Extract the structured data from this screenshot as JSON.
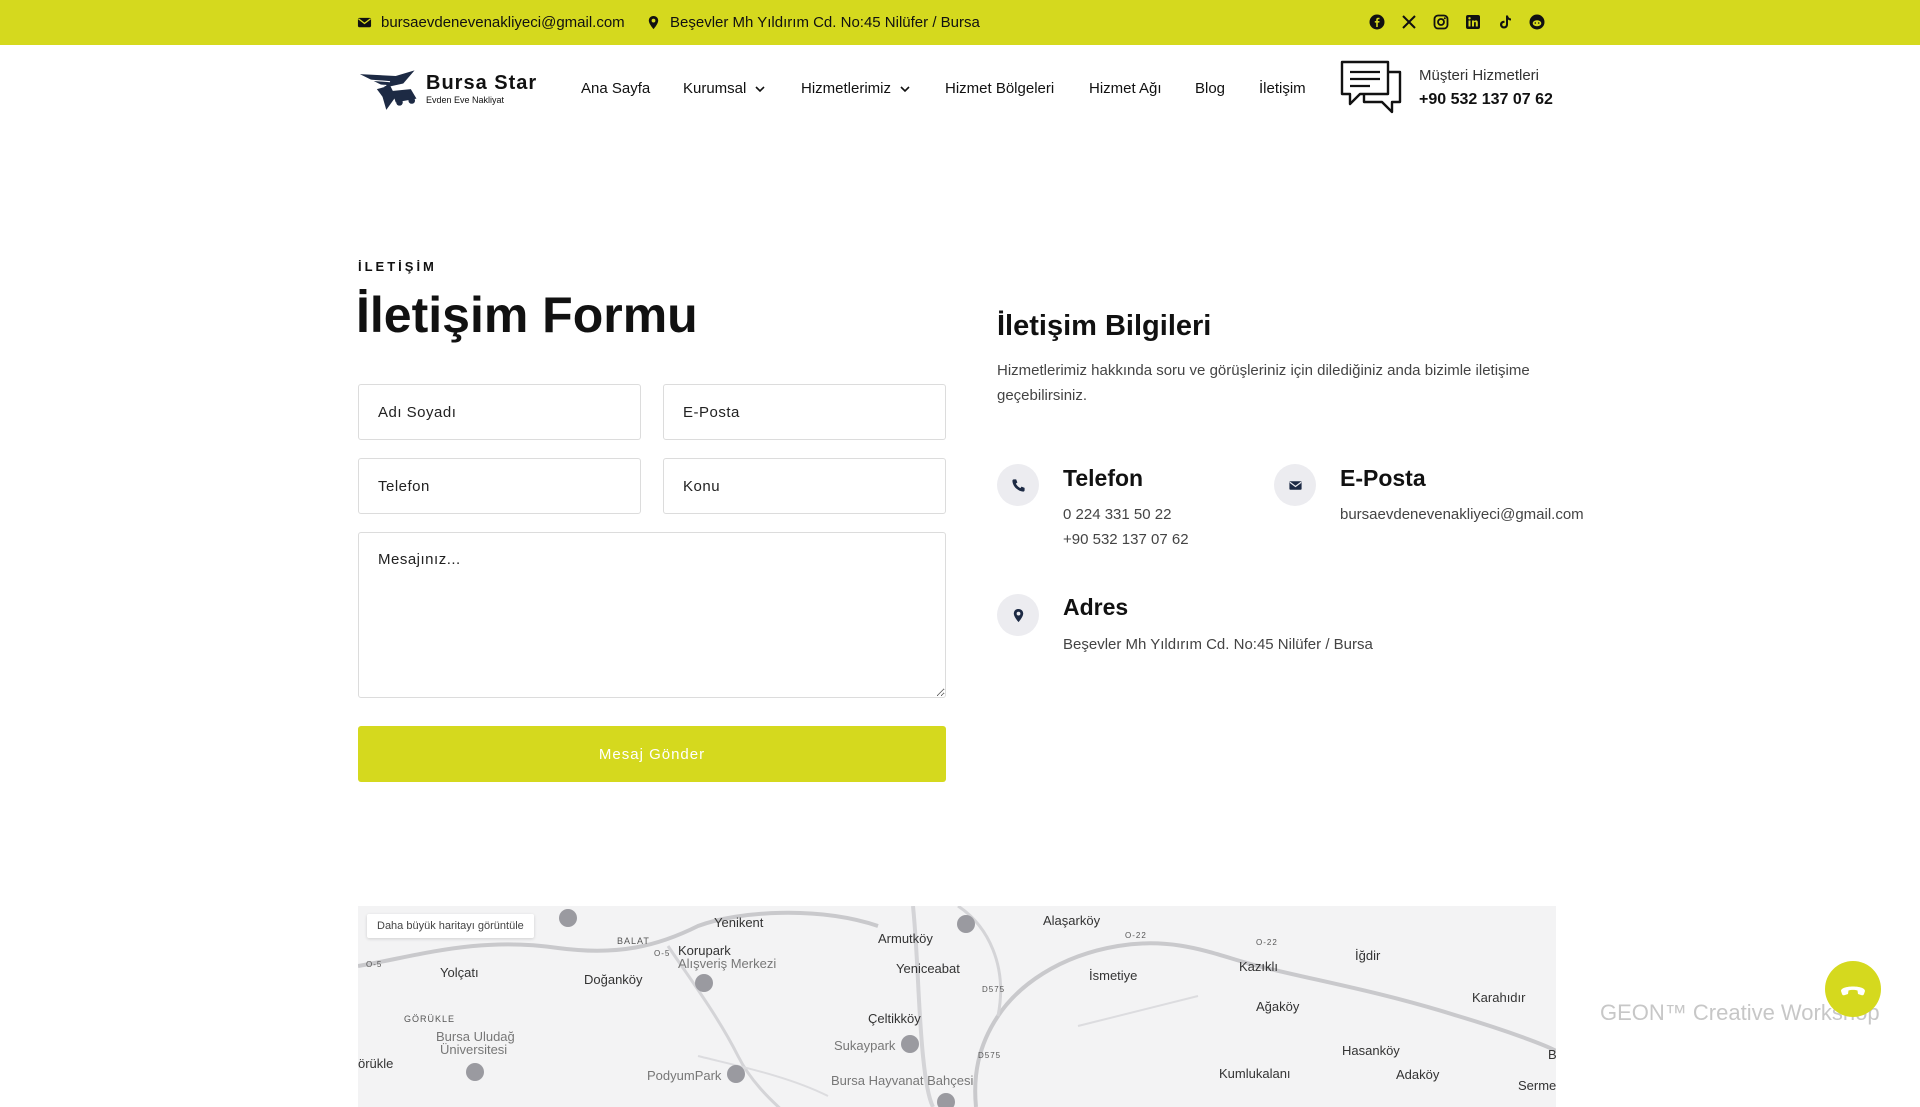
{
  "topbar": {
    "email": "bursaevdenevenakliyeci@gmail.com",
    "address": "Beşevler Mh Yıldırım Cd. No:45 Nilüfer / Bursa",
    "social": [
      "facebook-icon",
      "x-icon",
      "instagram-icon",
      "linkedin-icon",
      "tiktok-icon",
      "reddit-icon"
    ]
  },
  "header": {
    "logo_name": "Bursa Star",
    "logo_tagline": "Evden Eve Nakliyat",
    "nav": [
      {
        "label": "Ana Sayfa"
      },
      {
        "label": "Kurumsal"
      },
      {
        "label": "Hizmetlerimiz"
      },
      {
        "label": "Hizmet Bölgeleri"
      },
      {
        "label": "Hizmet Ağı"
      },
      {
        "label": "Blog"
      },
      {
        "label": "İletişim"
      }
    ],
    "support_label": "Müşteri Hizmetleri",
    "support_phone": "+90 532 137 07 62"
  },
  "form": {
    "eyebrow": "İLETİŞİM",
    "title": "İletişim Formu",
    "name_placeholder": "Adı Soyadı",
    "email_placeholder": "E-Posta",
    "phone_placeholder": "Telefon",
    "subject_placeholder": "Konu",
    "message_placeholder": "Mesajınız...",
    "submit_label": "Mesaj Gönder"
  },
  "info": {
    "title": "İletişim Bilgileri",
    "description": "Hizmetlerimiz hakkında soru ve görüşleriniz için dilediğiniz anda bizimle iletişime geçebilirsiniz.",
    "phone_heading": "Telefon",
    "phone_1": "0 224 331 50 22",
    "phone_2": "+90 532 137 07 62",
    "email_heading": "E-Posta",
    "email_value": "bursaevdenevenakliyeci@gmail.com",
    "address_heading": "Adres",
    "address_value": "Beşevler Mh Yıldırım Cd. No:45 Nilüfer / Bursa"
  },
  "map": {
    "larger_map": "Daha büyük haritayı görüntüle",
    "labels": {
      "yenikent": "Yenikent",
      "armutkoy": "Armutköy",
      "alasarkoy": "Alaşarköy",
      "igdir": "İğdir",
      "balat": "BALAT",
      "korupark": "Korupark",
      "korupark2": "Alışveriş Merkezi",
      "yeniceabat": "Yeniceabat",
      "ismetiye": "İsmetiye",
      "kazikli": "Kazıklı",
      "karahidir": "Karahıdır",
      "yolcati": "Yolçatı",
      "dogankoy": "Doğanköy",
      "agakoy": "Ağaköy",
      "gorukle": "GÖRÜKLE",
      "uludag1": "Bursa Uludağ",
      "uludag2": "Üniversitesi",
      "celtikkoy": "Çeltikköy",
      "sukaypark": "Sukaypark",
      "hasankoy": "Hasanköy",
      "orukle": "örükle",
      "podyumpark": "PodyumPark",
      "hayvanat": "Bursa Hayvanat Bahçesi",
      "kumlukalani": "Kumlukalanı",
      "adakoy": "Adaköy",
      "serme": "Serme",
      "b": "B",
      "d575a": "D575",
      "d575b": "D575",
      "o22a": "O-22",
      "o22b": "O-22",
      "o5a": "O-5",
      "o5b": "O-5"
    }
  },
  "watermark": "GEON™ Creative Workshop",
  "colors": {
    "accent": "#d5d91e",
    "text": "#111111",
    "muted": "#444444",
    "icon_bg": "#ececf0"
  }
}
